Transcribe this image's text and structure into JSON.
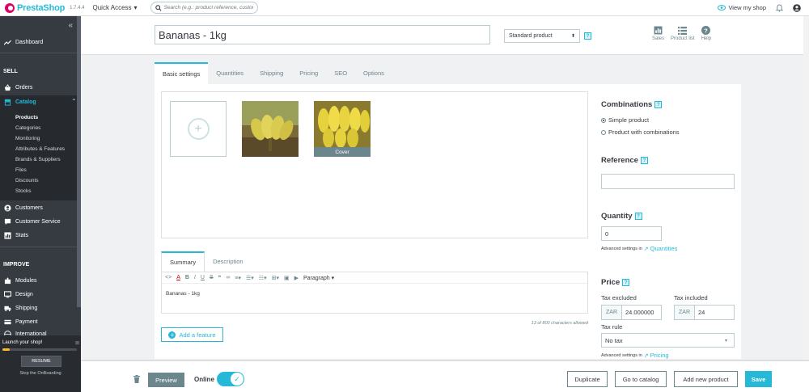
{
  "header": {
    "brand": "PrestaShop",
    "version": "1.7.4.4",
    "quick_access": "Quick Access",
    "search_placeholder": "Search (e.g.: product reference, custome",
    "view_shop": "View my shop"
  },
  "sidebar": {
    "dashboard": "Dashboard",
    "section_sell": "SELL",
    "orders": "Orders",
    "catalog": "Catalog",
    "catalog_sub": [
      "Products",
      "Categories",
      "Monitoring",
      "Attributes & Features",
      "Brands & Suppliers",
      "Files",
      "Discounts",
      "Stocks"
    ],
    "customers": "Customers",
    "customer_service": "Customer Service",
    "stats": "Stats",
    "section_improve": "IMPROVE",
    "modules": "Modules",
    "design": "Design",
    "shipping": "Shipping",
    "payment": "Payment",
    "international": "International",
    "onboarding": {
      "title": "Launch your shop!",
      "progress": 0.1,
      "resume": "RESUME",
      "stop": "Stop the OnBoarding"
    }
  },
  "product": {
    "name": "Bananas - 1kg",
    "type": "Standard product",
    "tools": [
      "Sales",
      "Product list",
      "Help"
    ]
  },
  "tabs": [
    "Basic settings",
    "Quantities",
    "Shipping",
    "Pricing",
    "SEO",
    "Options"
  ],
  "images": {
    "cover_label": "Cover"
  },
  "editor": {
    "tabs": [
      "Summary",
      "Description"
    ],
    "paragraph": "Paragraph",
    "content": "Bananas - 1kg",
    "char_count": "13 of 800 characters allowed",
    "add_feature": "Add a feature"
  },
  "right": {
    "combinations_title": "Combinations",
    "simple": "Simple product",
    "with_combinations": "Product with combinations",
    "reference_title": "Reference",
    "reference_value": "",
    "quantity_title": "Quantity",
    "quantity_value": "0",
    "advanced_in": "Advanced settings in",
    "quantities_link": "Quantities",
    "price_title": "Price",
    "tax_excluded": "Tax excluded",
    "tax_included": "Tax included",
    "currency": "ZAR",
    "price_excl": "24.000000",
    "price_incl": "24",
    "tax_rule": "Tax rule",
    "tax_rule_value": "No tax",
    "pricing_link": "Pricing"
  },
  "footer": {
    "preview": "Preview",
    "online": "Online",
    "duplicate": "Duplicate",
    "go_catalog": "Go to catalog",
    "add_new": "Add new product",
    "save": "Save"
  }
}
